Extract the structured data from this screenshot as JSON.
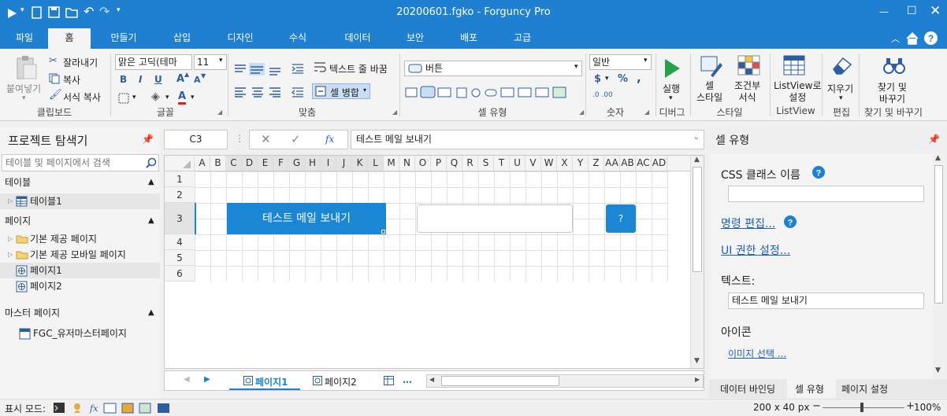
{
  "titlebar": {
    "title": "20200601.fgko - Forguncy Pro"
  },
  "menu": [
    "파일",
    "홈",
    "만들기",
    "삽입",
    "디자인",
    "수식",
    "데이터",
    "보안",
    "배포",
    "고급"
  ],
  "ribbon": {
    "paste": "붙여넣기",
    "cut": "잘라내기",
    "copy": "복사",
    "format_copy": "서식 복사",
    "clipboard": "클립보드",
    "font_name": "맑은 고딕(테마",
    "font_size": "11",
    "font_bold": "B",
    "font_italic": "I",
    "font_underline": "U",
    "font_grow": "A",
    "font_shrink": "A",
    "font_color_letter": "A",
    "font_group": "글꼴",
    "wrap_text": "텍스트 줄 바꿈",
    "merge_cells": "셀 병합",
    "align_group": "맞춤",
    "cell_type_value": "버튼",
    "cell_type_group": "셀 유형",
    "number_format": "일반",
    "currency_symbol": "$",
    "comma_symbol": ",",
    "percent_symbol": "%",
    "number_group": "숫자",
    "run": "실행",
    "debug_group": "디버그",
    "cell_style": "셀\n스타일",
    "conditional_format": "조건부\n서식",
    "style_group": "스타일",
    "listview_settings": "ListView로\n설정",
    "listview_group": "ListView",
    "clear": "지우기",
    "edit_group": "편집",
    "find_replace": "찾기 및\n바꾸기",
    "find_group": "찾기 및 바꾸기"
  },
  "explorer": {
    "title": "프로젝트 탐색기",
    "search_placeholder": "테이블 및 페이지에서 검색",
    "tables_header": "테이블",
    "tables": [
      "테이블1"
    ],
    "pages_header": "페이지",
    "page_folders": [
      "기본 제공 페이지",
      "기본 제공 모바일 페이지"
    ],
    "pages": [
      "페이지1",
      "페이지2"
    ],
    "master_header": "마스터 페이지",
    "masters": [
      "FGC_유저마스터페이지"
    ]
  },
  "formula": {
    "cell_ref": "C3",
    "fx": "fx",
    "value": "테스트 메일 보내기"
  },
  "grid": {
    "columns": [
      "A",
      "B",
      "C",
      "D",
      "E",
      "F",
      "G",
      "H",
      "I",
      "J",
      "K",
      "L",
      "M",
      "N",
      "O",
      "P",
      "Q",
      "R",
      "S",
      "T",
      "U",
      "V",
      "W",
      "X",
      "Y",
      "Z",
      "AA",
      "AB",
      "AC",
      "AD"
    ],
    "rows": [
      "1",
      "2",
      "3",
      "4",
      "5",
      "6"
    ],
    "button_text": "테스트 메일 보내기",
    "help_button": "?"
  },
  "sheet_tabs": [
    "페이지1",
    "페이지2",
    "…"
  ],
  "panel": {
    "title": "셀 유형",
    "css_class_label": "CSS 클래스 이름",
    "css_class_value": "",
    "command_edit": "명령 편집...",
    "ui_permission": "UI 권한 설정...",
    "text_label": "텍스트:",
    "text_value": "테스트 메일 보내기",
    "icon_label": "아이콘",
    "image_select": "이미지 선택 ...",
    "tabs": [
      "데이터 바인딩",
      "셀 유형",
      "페이지 설정"
    ]
  },
  "status": {
    "display_mode": "표시 모드:",
    "cell_size": "200 x 40 px",
    "zoom": "100%"
  },
  "colors": {
    "accent": "#1f7fd1",
    "button": "#1b86d3"
  }
}
